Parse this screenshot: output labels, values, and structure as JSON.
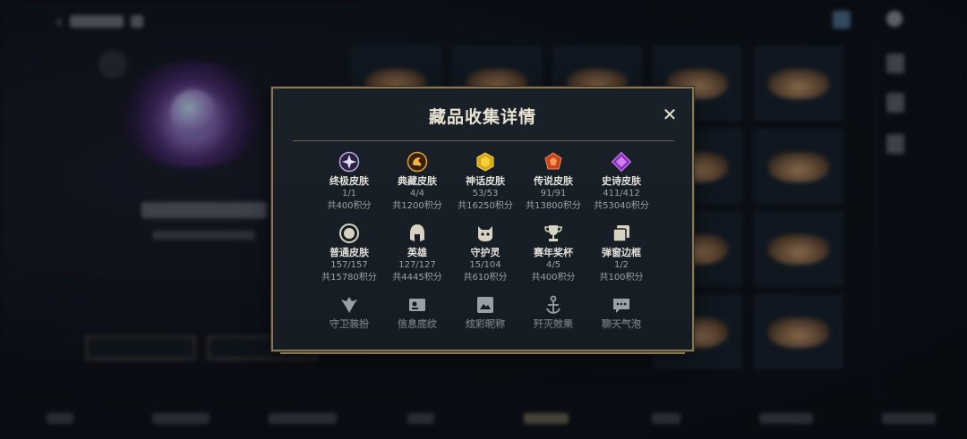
{
  "modal": {
    "title": "藏品收集详情",
    "close_label": "✕"
  },
  "items": [
    {
      "name": "终极皮肤",
      "count": "1/1",
      "points": "共400积分",
      "icon": "ultimate-skin-icon",
      "color": "#b9a7e0"
    },
    {
      "name": "典藏皮肤",
      "count": "4/4",
      "points": "共1200积分",
      "icon": "collector-skin-icon",
      "color": "#c98a2a"
    },
    {
      "name": "神话皮肤",
      "count": "53/53",
      "points": "共16250积分",
      "icon": "mythic-skin-icon",
      "color": "#e0b323"
    },
    {
      "name": "传说皮肤",
      "count": "91/91",
      "points": "共13800积分",
      "icon": "legendary-skin-icon",
      "color": "#e0602a"
    },
    {
      "name": "史诗皮肤",
      "count": "411/412",
      "points": "共53040积分",
      "icon": "epic-skin-icon",
      "color": "#a04ad0"
    },
    {
      "name": "普通皮肤",
      "count": "157/157",
      "points": "共15780积分",
      "icon": "standard-skin-icon",
      "color": "#d8d2c2"
    },
    {
      "name": "英雄",
      "count": "127/127",
      "points": "共4445积分",
      "icon": "hero-helmet-icon",
      "color": "#d8d2c2"
    },
    {
      "name": "守护灵",
      "count": "15/104",
      "points": "共610积分",
      "icon": "guardian-pet-icon",
      "color": "#d8d2c2"
    },
    {
      "name": "赛年奖杯",
      "count": "4/5",
      "points": "共400积分",
      "icon": "trophy-icon",
      "color": "#d8d2c2"
    },
    {
      "name": "弹窗边框",
      "count": "1/2",
      "points": "共100积分",
      "icon": "popup-frame-icon",
      "color": "#d8d2c2"
    },
    {
      "name": "守卫装扮",
      "icon": "ward-skin-icon",
      "color": "#9aa0a8"
    },
    {
      "name": "信息底纹",
      "icon": "info-card-icon",
      "color": "#9aa0a8"
    },
    {
      "name": "炫彩昵称",
      "icon": "colorful-nickname-icon",
      "color": "#9aa0a8"
    },
    {
      "name": "歼灭效果",
      "icon": "kill-effect-icon",
      "color": "#9aa0a8"
    },
    {
      "name": "聊天气泡",
      "icon": "chat-bubble-icon",
      "color": "#9aa0a8"
    }
  ]
}
